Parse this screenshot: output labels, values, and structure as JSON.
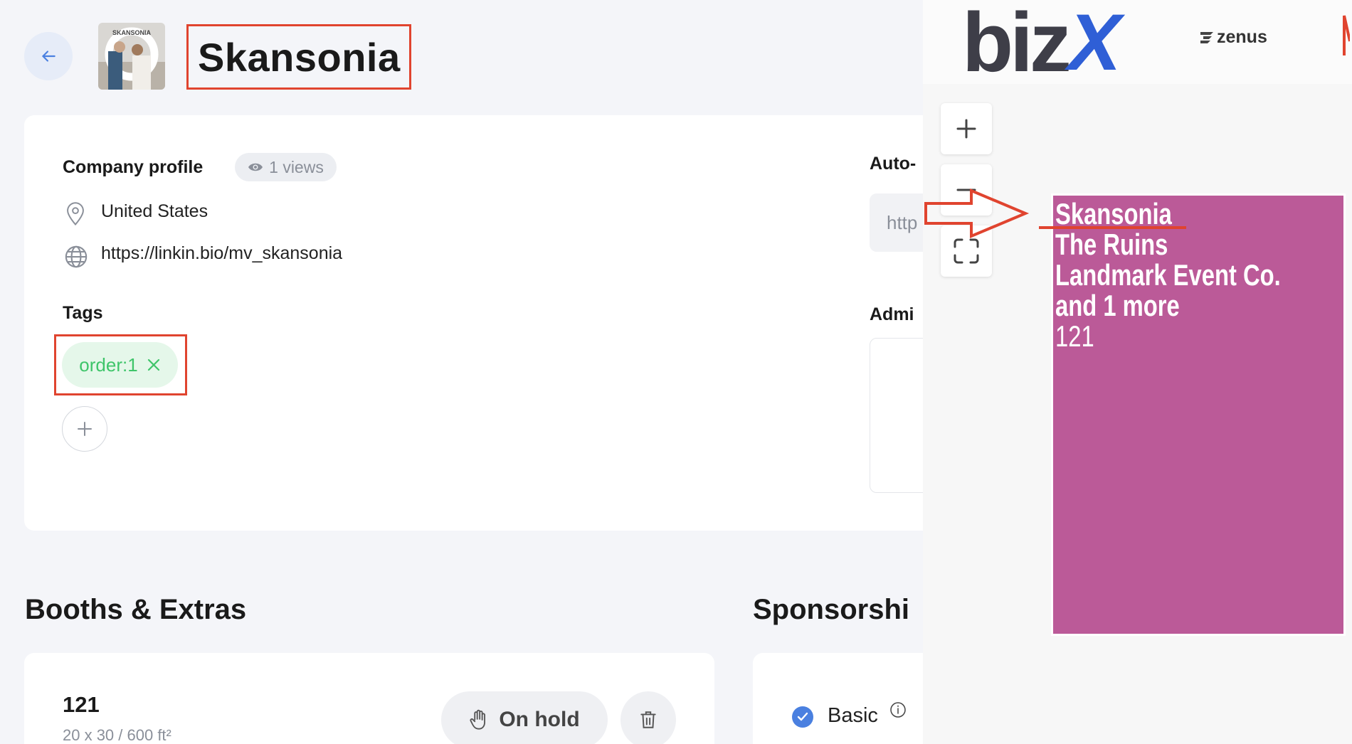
{
  "header": {
    "company_name": "Skansonia",
    "back_icon": "arrow-left-icon",
    "avatar_badge_text": "SKANSONIA"
  },
  "profile": {
    "heading": "Company profile",
    "views": "1 views",
    "country": "United States",
    "website": "https://linkin.bio/mv_skansonia"
  },
  "tags": {
    "heading": "Tags",
    "items": [
      "order:1"
    ]
  },
  "side_column": {
    "heading_1": "Auto-",
    "input_value": "http",
    "heading_2": "Admi"
  },
  "booths": {
    "heading": "Booths & Extras",
    "number": "121",
    "size": "20 x 30 / 600 ft²",
    "status_label": "On hold"
  },
  "sponsorships": {
    "heading": "Sponsorshi",
    "item_label": "Basic"
  },
  "floorplan": {
    "logo_text": "biz",
    "logo_x": "X",
    "partner_logo": "zenus",
    "booth_lines": [
      "Skansonia",
      "The Ruins",
      "Landmark Event Co.",
      "and 1 more"
    ],
    "booth_number": "121",
    "booth_color": "#bb5a98"
  },
  "colors": {
    "accent_blue": "#4a80e0",
    "annotation_red": "#e0442f",
    "tag_green": "#3fc56a"
  }
}
